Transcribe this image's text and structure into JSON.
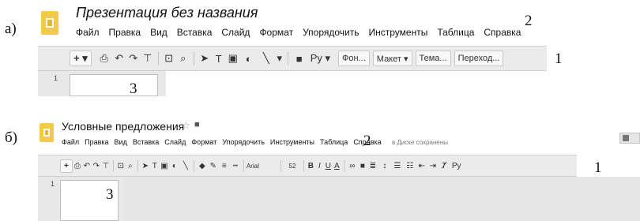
{
  "panel_a": {
    "letter": "а)",
    "title": "Презентация без названия",
    "menu": [
      "Файл",
      "Правка",
      "Вид",
      "Вставка",
      "Слайд",
      "Формат",
      "Упорядочить",
      "Инструменты",
      "Таблица",
      "Справка"
    ],
    "toolbar": {
      "add": "+ ▾",
      "font_btn": "Ру ▾",
      "buttons": [
        "Фон...",
        "Макет ▾",
        "Тема...",
        "Переход..."
      ]
    },
    "slide_number": "1",
    "callouts": {
      "menu_area": "2",
      "toolbar_area": "1",
      "slides_area": "3"
    }
  },
  "panel_b": {
    "letter": "б)",
    "title": "Условные предложения",
    "menu": [
      "Файл",
      "Правка",
      "Вид",
      "Вставка",
      "Слайд",
      "Формат",
      "Упорядочить",
      "Инструменты",
      "Таблица",
      "Справка"
    ],
    "saved_status": "в Диске сохранены",
    "toolbar": {
      "font": "Arial",
      "size": "52",
      "bold": "B",
      "italic": "I",
      "underline": "U",
      "text_color": "A",
      "font_btn": "Ру"
    },
    "slide_number": "1",
    "callouts": {
      "menu_area": "2",
      "toolbar_area": "1",
      "slides_area": "3"
    }
  }
}
